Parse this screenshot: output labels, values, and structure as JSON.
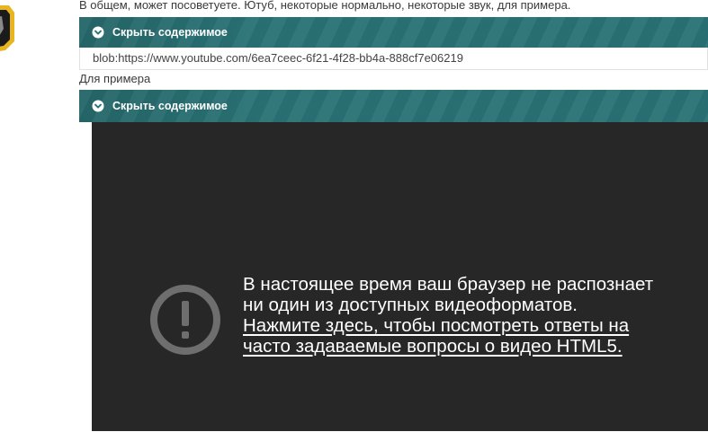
{
  "post": {
    "line1": "В общем, может посоветуете. Ютуб, некоторые нормально, некоторые звук, для примера.",
    "line2": "Для примера"
  },
  "spoiler1": {
    "toggle_label": "Скрыть содержимое",
    "content": "blob:https://www.youtube.com/6ea7ceec-6f21-4f28-bb4a-888cf7e06219"
  },
  "spoiler2": {
    "toggle_label": "Скрыть содержимое"
  },
  "video": {
    "message_line1": "В настоящее время ваш браузер не распознает",
    "message_line2": "ни один из доступных видеоформатов.",
    "link_line1": "Нажмите здесь, чтобы посмотреть ответы на",
    "link_line2": "часто задаваемые вопросы о видео HTML5."
  },
  "icons": {
    "toggle": "chevron-circle-down-icon",
    "warning": "exclamation-circle-icon",
    "avatar": "shield-badge-icon"
  },
  "colors": {
    "spoiler_header": "#2a7376",
    "video_background": "#272727",
    "warning_icon": "#6e6e6e"
  }
}
